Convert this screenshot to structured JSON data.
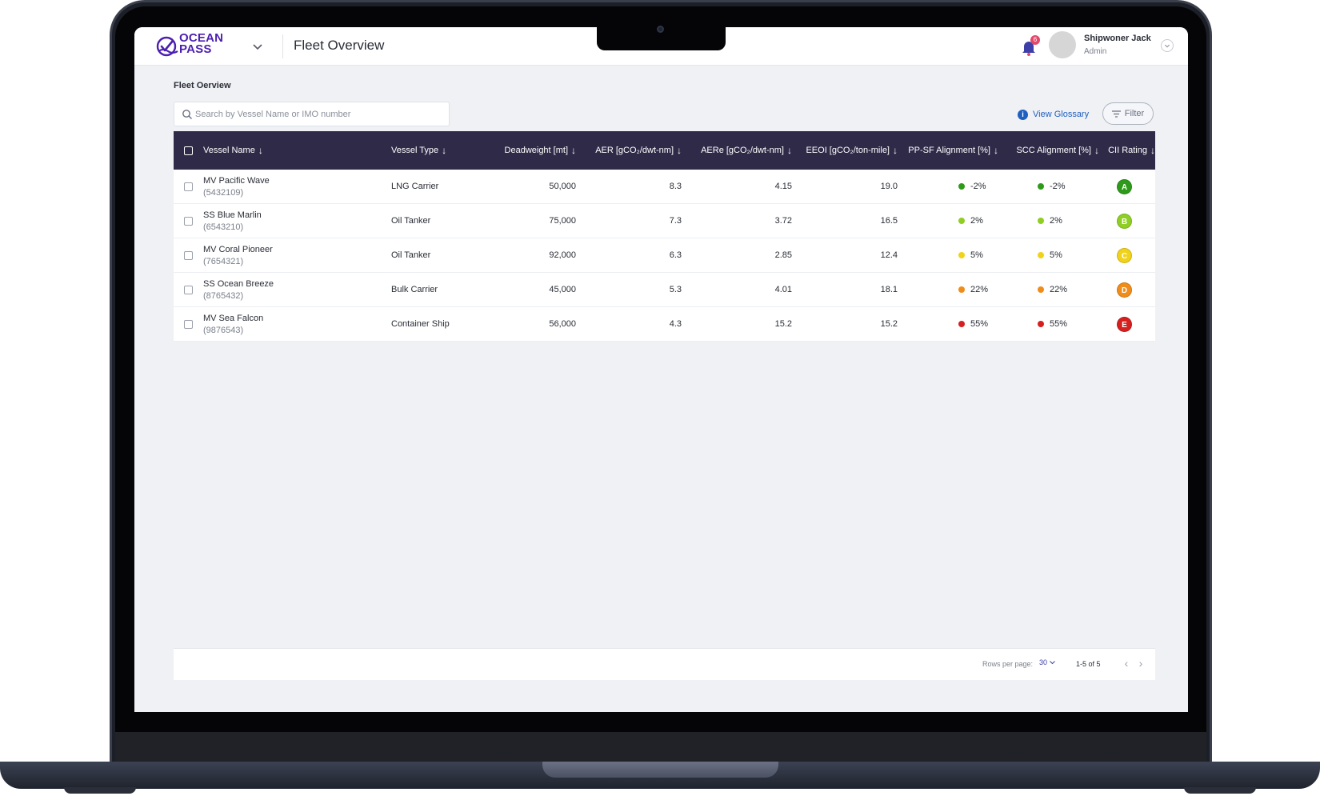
{
  "app": {
    "logo_text_line1": "OCEAN",
    "logo_text_line2": "PASS",
    "title": "Fleet Overview",
    "notification_count": "6"
  },
  "user": {
    "name": "Shipwoner Jack",
    "role": "Admin"
  },
  "breadcrumb": "Fleet Oerview",
  "search": {
    "placeholder": "Search by Vessel Name or IMO number",
    "value": ""
  },
  "actions": {
    "glossary_label": "View Glossary",
    "filter_label": "Filter"
  },
  "table": {
    "headers": {
      "vessel_name": "Vessel Name",
      "vessel_type": "Vessel Type",
      "deadweight": "Deadweight [mt]",
      "aer": "AER [gCO₂/dwt-nm]",
      "aere": "AERe [gCO₂/dwt-nm]",
      "eeoi": "EEOI [gCO₂/ton-mile]",
      "ppsf": "PP-SF Alignment [%]",
      "scc": "SCC Alignment [%]",
      "cii": "CII Rating"
    },
    "rows": [
      {
        "name": "MV Pacific Wave",
        "imo": "(5432109)",
        "type": "LNG Carrier",
        "deadweight": "50,000",
        "aer": "8.3",
        "aere": "4.15",
        "eeoi": "19.0",
        "ppsf": "-2%",
        "scc": "-2%",
        "cii": "A"
      },
      {
        "name": "SS Blue Marlin",
        "imo": "(6543210)",
        "type": "Oil Tanker",
        "deadweight": "75,000",
        "aer": "7.3",
        "aere": "3.72",
        "eeoi": "16.5",
        "ppsf": "2%",
        "scc": "2%",
        "cii": "B"
      },
      {
        "name": "MV Coral Pioneer",
        "imo": "(7654321)",
        "type": "Oil Tanker",
        "deadweight": "92,000",
        "aer": "6.3",
        "aere": "2.85",
        "eeoi": "12.4",
        "ppsf": "5%",
        "scc": "5%",
        "cii": "C"
      },
      {
        "name": "SS Ocean Breeze",
        "imo": "(8765432)",
        "type": "Bulk Carrier",
        "deadweight": "45,000",
        "aer": "5.3",
        "aere": "4.01",
        "eeoi": "18.1",
        "ppsf": "22%",
        "scc": "22%",
        "cii": "D"
      },
      {
        "name": "MV Sea Falcon",
        "imo": "(9876543)",
        "type": "Container Ship",
        "deadweight": "56,000",
        "aer": "4.3",
        "aere": "15.2",
        "eeoi": "15.2",
        "ppsf": "55%",
        "scc": "55%",
        "cii": "E"
      }
    ]
  },
  "status_colors": {
    "A": "#2e9a1a",
    "B": "#8fce23",
    "C": "#f1d21b",
    "D": "#f08c1a",
    "E": "#d61f1f"
  },
  "pagination": {
    "rows_per_page_label": "Rows per page:",
    "rows_per_page_value": "30",
    "range": "1-5 of 5"
  }
}
